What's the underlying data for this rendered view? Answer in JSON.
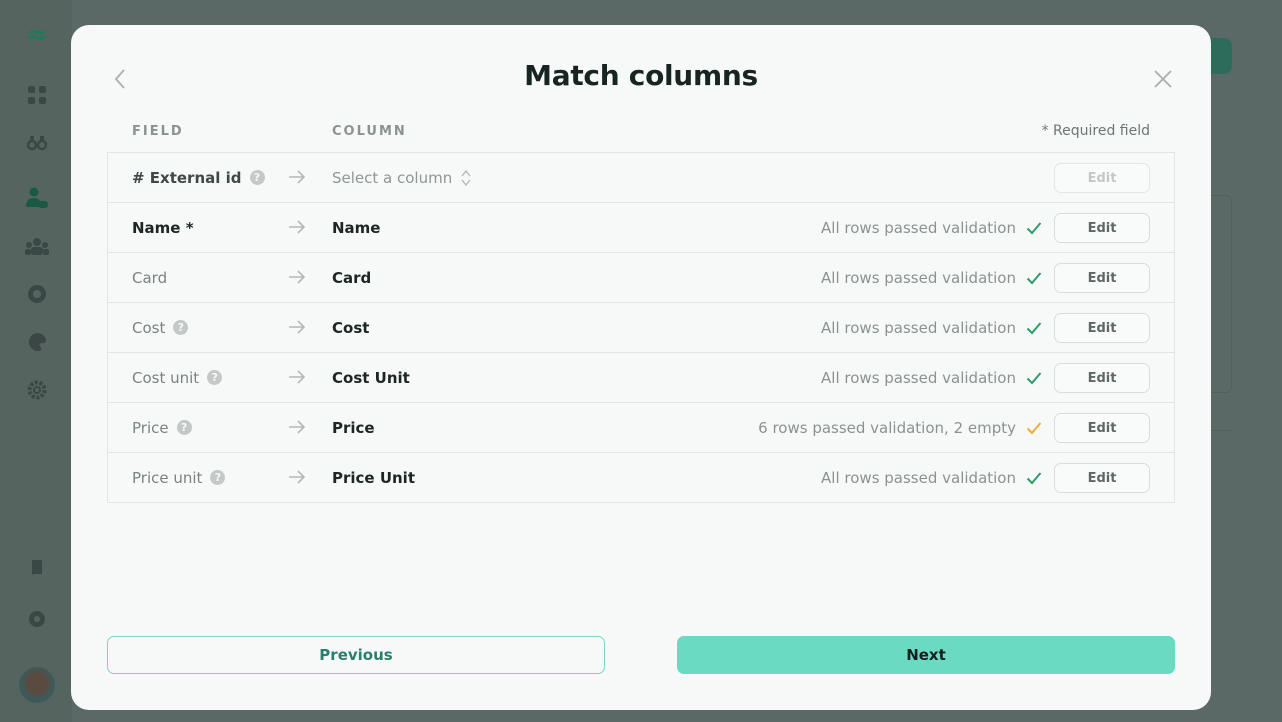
{
  "background_app": {
    "sidebar": {
      "items": [
        {
          "icon": "logo-waves-icon",
          "glyph": "≈"
        },
        {
          "icon": "dashboard-grid-icon",
          "glyph": "▦"
        },
        {
          "icon": "binoculars-icon",
          "glyph": "∞"
        },
        {
          "icon": "user-card-icon",
          "glyph": "👤",
          "active": true
        },
        {
          "icon": "team-icon",
          "glyph": "☷"
        },
        {
          "icon": "globe-icon",
          "glyph": "◍"
        },
        {
          "icon": "palette-icon",
          "glyph": "◕"
        },
        {
          "icon": "settings-gear-icon",
          "glyph": "✲"
        },
        {
          "icon": "book-icon",
          "glyph": "▙"
        },
        {
          "icon": "help-icon",
          "glyph": "?"
        }
      ]
    }
  },
  "modal": {
    "title": "Match columns",
    "headers": {
      "field": "FIELD",
      "column": "COLUMN",
      "required_note": "* Required field"
    },
    "rows": [
      {
        "field": "# External id",
        "has_help": true,
        "style": "ext",
        "column": "",
        "column_placeholder": "Select a column",
        "status": "",
        "status_state": "none",
        "edit_label": "Edit",
        "edit_disabled": true
      },
      {
        "field": "Name *",
        "has_help": false,
        "style": "strong",
        "column": "Name",
        "status": "All rows passed validation",
        "status_state": "success",
        "edit_label": "Edit",
        "edit_disabled": false
      },
      {
        "field": "Card",
        "has_help": false,
        "style": "normal",
        "column": "Card",
        "status": "All rows passed validation",
        "status_state": "success",
        "edit_label": "Edit",
        "edit_disabled": false
      },
      {
        "field": "Cost",
        "has_help": true,
        "style": "normal",
        "column": "Cost",
        "status": "All rows passed validation",
        "status_state": "success",
        "edit_label": "Edit",
        "edit_disabled": false
      },
      {
        "field": "Cost unit",
        "has_help": true,
        "style": "normal",
        "column": "Cost Unit",
        "status": "All rows passed validation",
        "status_state": "success",
        "edit_label": "Edit",
        "edit_disabled": false
      },
      {
        "field": "Price",
        "has_help": true,
        "style": "normal",
        "column": "Price",
        "status": "6 rows passed validation, 2 empty",
        "status_state": "warning",
        "edit_label": "Edit",
        "edit_disabled": false
      },
      {
        "field": "Price unit",
        "has_help": true,
        "style": "normal",
        "column": "Price Unit",
        "status": "All rows passed validation",
        "status_state": "success",
        "edit_label": "Edit",
        "edit_disabled": false
      }
    ],
    "help_glyph": "?",
    "buttons": {
      "previous": "Previous",
      "next": "Next"
    },
    "colors": {
      "success": "#2e9b6a",
      "warning": "#f2a93b",
      "accent": "#6bdac3",
      "accent_text": "#2a7f6c"
    }
  }
}
